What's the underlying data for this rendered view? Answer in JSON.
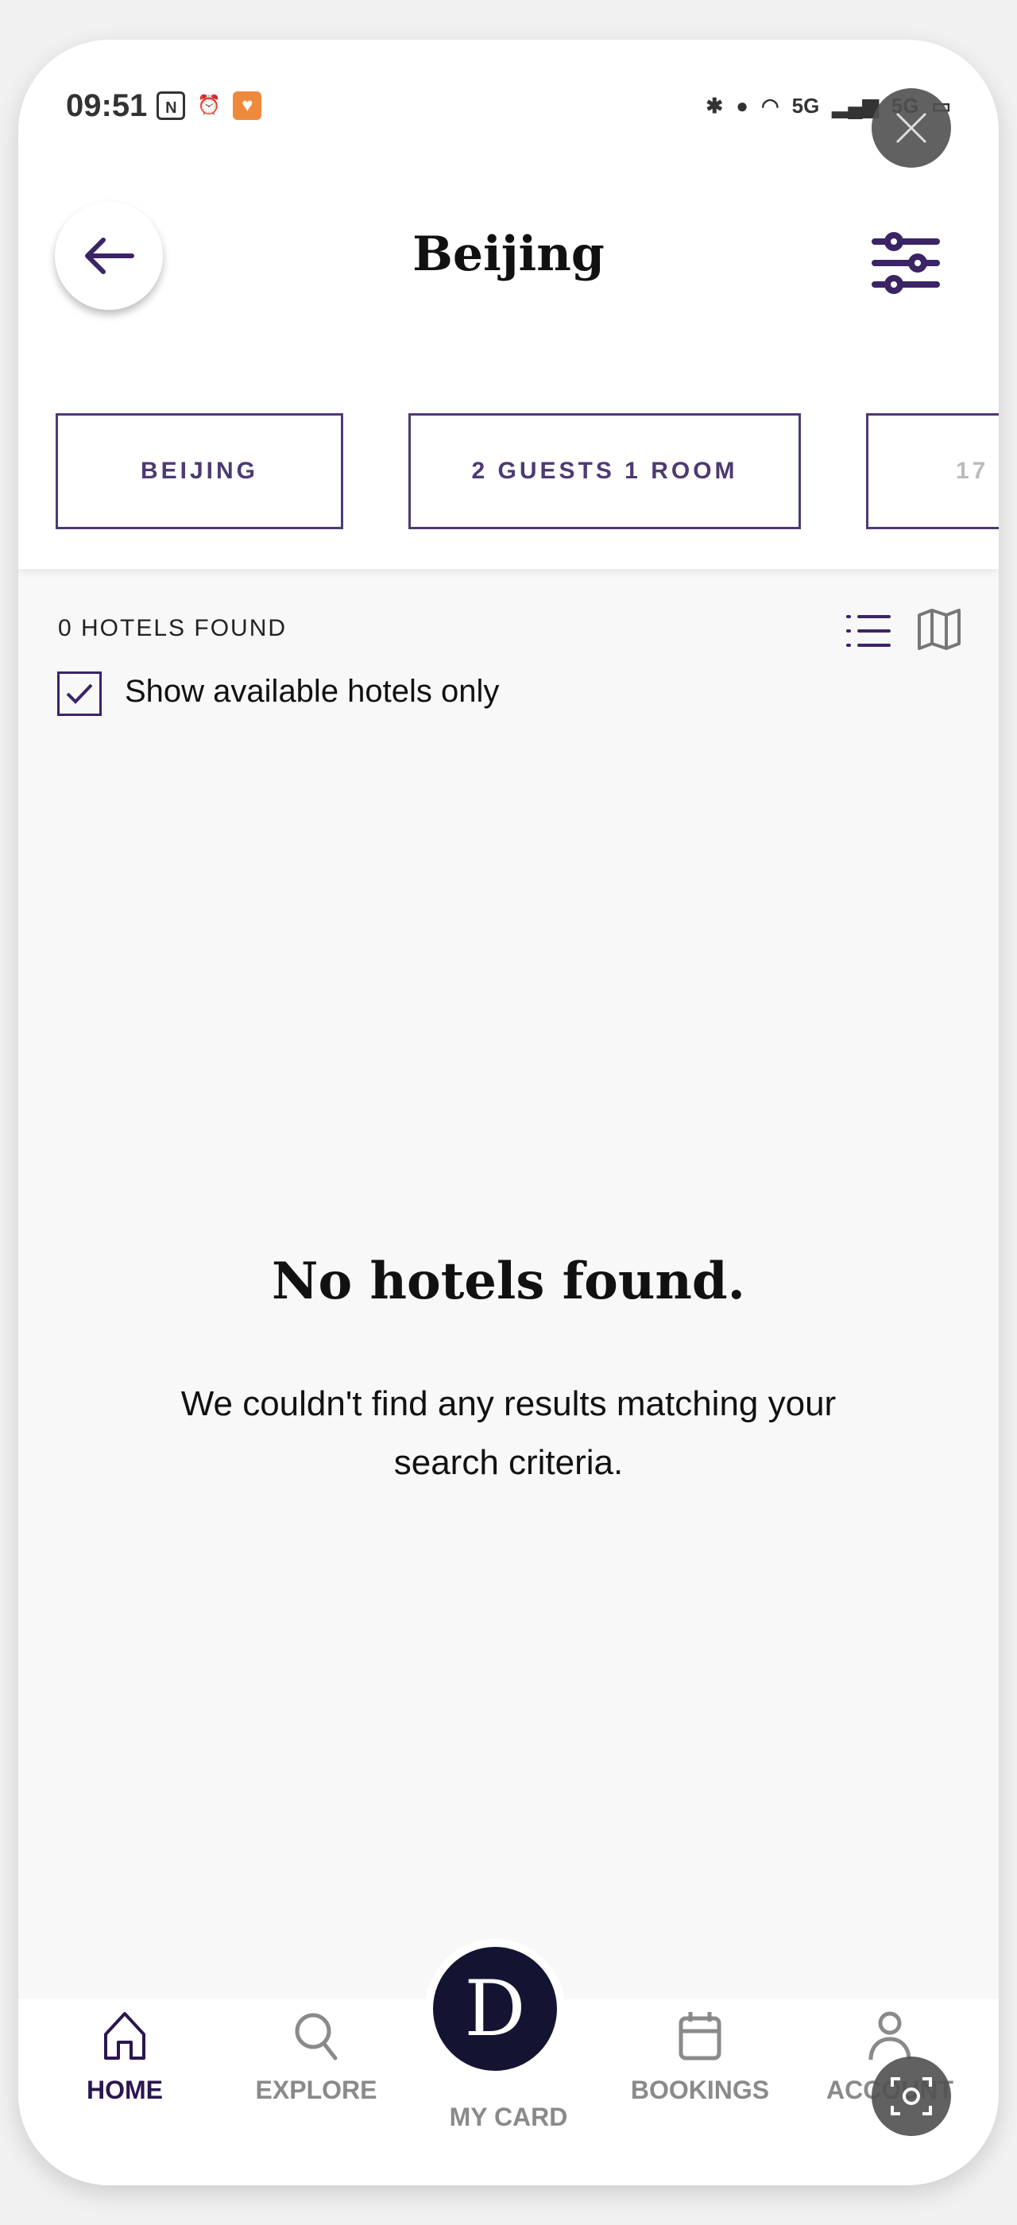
{
  "status_bar": {
    "time": "09:51",
    "network_labels": [
      "5G",
      "5G"
    ]
  },
  "header": {
    "title": "Beijing",
    "back_icon": "arrow-left-icon",
    "filter_icon": "sliders-icon"
  },
  "chips": [
    {
      "label": "BEIJING"
    },
    {
      "label": "2 GUESTS 1 ROOM"
    },
    {
      "label": "17"
    }
  ],
  "results": {
    "count_label": "0 HOTELS FOUND",
    "available_only_label": "Show available hotels only",
    "available_only_checked": true
  },
  "empty_state": {
    "title": "No hotels found.",
    "message": "We couldn't find any results matching your search criteria."
  },
  "nav": {
    "items": [
      {
        "label": "HOME",
        "icon": "home-icon",
        "active": true
      },
      {
        "label": "EXPLORE",
        "icon": "search-icon"
      },
      {
        "label": "MY CARD",
        "icon": "d-logo"
      },
      {
        "label": "BOOKINGS",
        "icon": "calendar-icon"
      },
      {
        "label": "ACCOUNT",
        "icon": "user-icon"
      }
    ],
    "card_logo": "D"
  },
  "colors": {
    "accent": "#3b2466",
    "chip_border": "#4d3a73",
    "card_bg": "#141432",
    "inactive": "#8a8a8a"
  }
}
